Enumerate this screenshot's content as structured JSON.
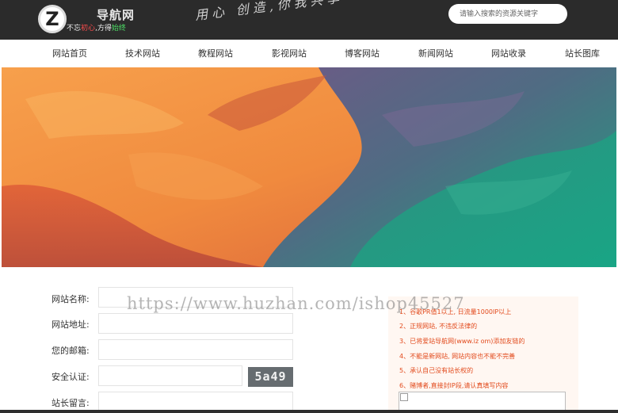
{
  "header": {
    "logo_letter": "Z",
    "site_title": "导航网",
    "slogan_prefix": "不忘",
    "slogan_hl1": "初心",
    "slogan_mid": ",方得",
    "slogan_hl2": "始终",
    "motto": "用心 创造,你我共享",
    "search_placeholder": "请输入搜索的资源关键字"
  },
  "nav": {
    "items": [
      "网站首页",
      "技术网站",
      "教程网站",
      "影视网站",
      "博客网站",
      "新闻网站",
      "网站收录",
      "站长图库"
    ]
  },
  "form": {
    "site_name_label": "网站名称:",
    "site_url_label": "网站地址:",
    "email_label": "您的邮箱:",
    "security_label": "安全认证:",
    "captcha_text": "5a49",
    "message_label": "站长留言:"
  },
  "notice": {
    "items": [
      "1、谷歌PR值1以上, 日流量1000IP以上",
      "2、正规网站, 不违反法律的",
      "3、已将爱站导航网(www.iz         om)添加友链的",
      "4、不能是新网站, 网站内容也不能不完善",
      "5、承认自己没有站长权的",
      "6、赌博者,直接封IP段,请认真填写内容"
    ]
  },
  "watermark": "https://www.huzhan.com/ishop45527",
  "colors": {
    "header_bg": "#2b2b2b",
    "notice_text": "#e24a1c",
    "notice_bg": "#fff7f2"
  }
}
